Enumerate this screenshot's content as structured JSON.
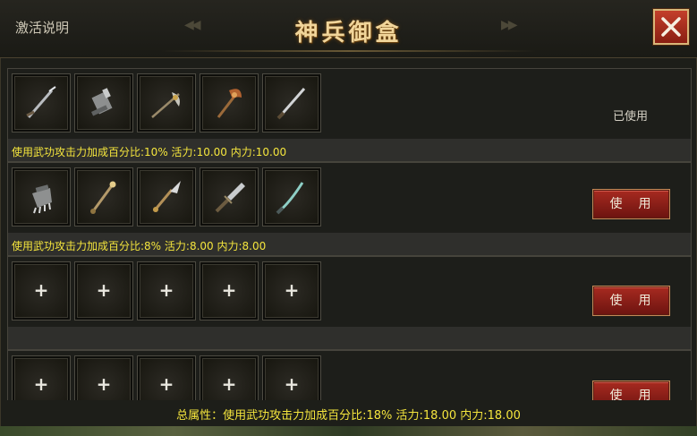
{
  "header": {
    "help_link": "激活说明",
    "title": "神兵御盒",
    "close_label": "close"
  },
  "rows": [
    {
      "slots": [
        {
          "icon": "sword-icon"
        },
        {
          "icon": "gauntlet-icon"
        },
        {
          "icon": "halberd-icon"
        },
        {
          "icon": "axe-icon"
        },
        {
          "icon": "blade-icon"
        }
      ],
      "status": "已使用",
      "attributes": "使用武功攻击力加成百分比:10% 活力:10.00 内力:10.00"
    },
    {
      "slots": [
        {
          "icon": "claw-glove-icon"
        },
        {
          "icon": "staff-icon"
        },
        {
          "icon": "spear-icon"
        },
        {
          "icon": "broadsword-icon"
        },
        {
          "icon": "curved-blade-icon"
        }
      ],
      "button": "使用",
      "attributes": "使用武功攻击力加成百分比:8% 活力:8.00 内力:8.00"
    },
    {
      "slots": [
        {
          "empty": "+"
        },
        {
          "empty": "+"
        },
        {
          "empty": "+"
        },
        {
          "empty": "+"
        },
        {
          "empty": "+"
        }
      ],
      "button": "使用",
      "attributes": ""
    },
    {
      "slots": [
        {
          "empty": "+"
        },
        {
          "empty": "+"
        },
        {
          "empty": "+"
        },
        {
          "empty": "+"
        },
        {
          "empty": "+"
        }
      ],
      "button": "使用",
      "attributes": ""
    }
  ],
  "footer": {
    "total": "总属性：使用武功攻击力加成百分比:18% 活力:18.00 内力:18.00"
  },
  "colors": {
    "highlight_text": "#f4e53d",
    "title_gold": "#f1d59a",
    "button_red": "#a72a20"
  }
}
